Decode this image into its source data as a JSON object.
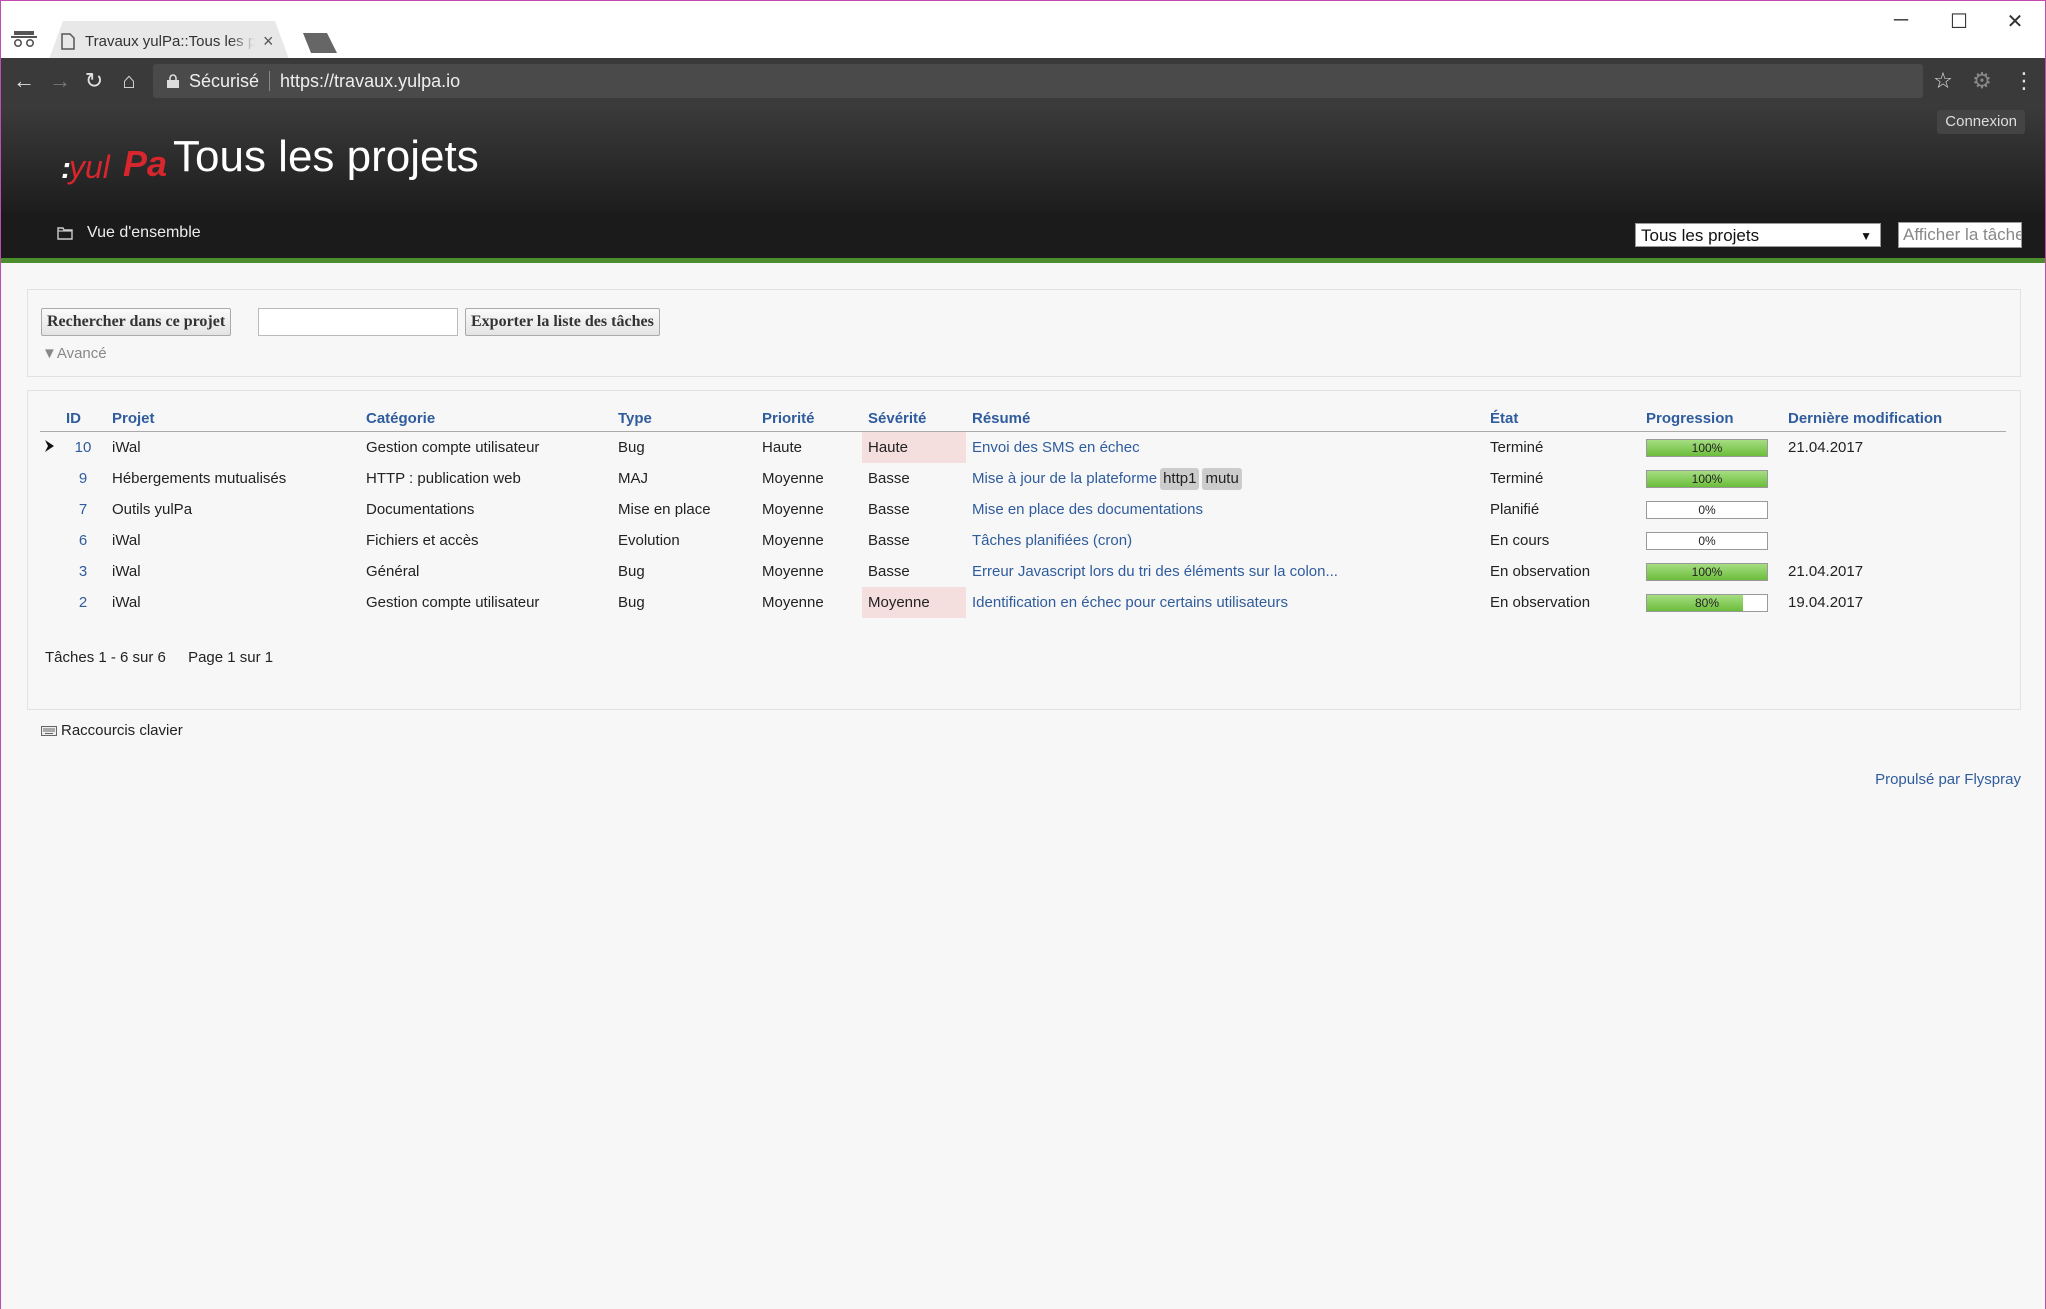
{
  "browser": {
    "tab_title": "Travaux yulPa::Tous les projets",
    "tab_close": "×",
    "secure_label": "Sécurisé",
    "url": "https://travaux.yulpa.io"
  },
  "header": {
    "logo_text": ":yulPa",
    "page_title": "Tous les projets",
    "login": "Connexion"
  },
  "nav": {
    "overview": "Vue d'ensemble",
    "project_select": "Tous les projets",
    "task_input_placeholder": "Afficher la tâche"
  },
  "search": {
    "search_button": "Rechercher dans ce projet",
    "export_button": "Exporter la liste des tâches",
    "advanced": "▼Avancé"
  },
  "table": {
    "headers": {
      "id": "ID",
      "project": "Projet",
      "category": "Catégorie",
      "type": "Type",
      "priority": "Priorité",
      "severity": "Sévérité",
      "summary": "Résumé",
      "state": "État",
      "progress": "Progression",
      "modified": "Dernière modification"
    },
    "rows": [
      {
        "id": "10",
        "project": "iWal",
        "category": "Gestion compte utilisateur",
        "type": "Bug",
        "priority": "Haute",
        "severity": "Haute",
        "summary": "Envoi des SMS en échec",
        "tags": [],
        "state": "Terminé",
        "progress": "100%",
        "progress_value": 100,
        "modified": "21.04.2017"
      },
      {
        "id": "9",
        "project": "Hébergements mutualisés",
        "category": "HTTP : publication web",
        "type": "MAJ",
        "priority": "Moyenne",
        "severity": "Basse",
        "summary": "Mise à jour de la plateforme",
        "tags": [
          "http1",
          "mutu"
        ],
        "state": "Terminé",
        "progress": "100%",
        "progress_value": 100,
        "modified": ""
      },
      {
        "id": "7",
        "project": "Outils yulPa",
        "category": "Documentations",
        "type": "Mise en place",
        "priority": "Moyenne",
        "severity": "Basse",
        "summary": "Mise en place des documentations",
        "tags": [],
        "state": "Planifié",
        "progress": "0%",
        "progress_value": 0,
        "modified": ""
      },
      {
        "id": "6",
        "project": "iWal",
        "category": "Fichiers et accès",
        "type": "Evolution",
        "priority": "Moyenne",
        "severity": "Basse",
        "summary": "Tâches planifiées (cron)",
        "tags": [],
        "state": "En cours",
        "progress": "0%",
        "progress_value": 0,
        "modified": ""
      },
      {
        "id": "3",
        "project": "iWal",
        "category": "Général",
        "type": "Bug",
        "priority": "Moyenne",
        "severity": "Basse",
        "summary": "Erreur Javascript lors du tri des éléments sur la colon...",
        "tags": [],
        "state": "En observation",
        "progress": "100%",
        "progress_value": 100,
        "modified": "21.04.2017"
      },
      {
        "id": "2",
        "project": "iWal",
        "category": "Gestion compte utilisateur",
        "type": "Bug",
        "priority": "Moyenne",
        "severity": "Moyenne",
        "summary": "Identification en échec pour certains utilisateurs",
        "tags": [],
        "state": "En observation",
        "progress": "80%",
        "progress_value": 80,
        "modified": "19.04.2017"
      }
    ]
  },
  "pagination": {
    "tasks": "Tâches 1 - 6 sur 6",
    "page": "Page 1 sur 1"
  },
  "footer": {
    "shortcuts": "Raccourcis clavier",
    "powered_by": "Propulsé par Flyspray"
  },
  "colors": {
    "link": "#2f5c9d",
    "nav_accent": "#4c8e2d",
    "severity_highlight": "#f5dede",
    "progress_fill": "#6cbd3c"
  }
}
